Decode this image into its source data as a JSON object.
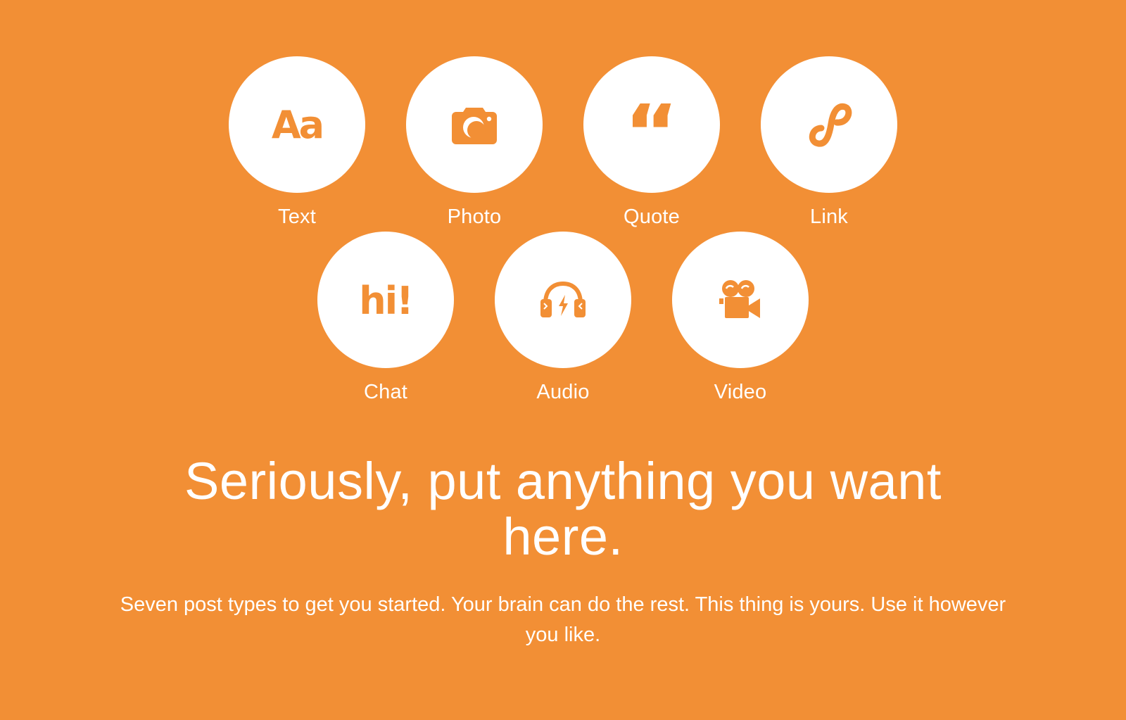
{
  "colors": {
    "background": "#f28f35",
    "circle": "#ffffff",
    "icon": "#f28f35",
    "text": "#ffffff"
  },
  "post_types": [
    {
      "label": "Text",
      "icon": "text-icon",
      "glyph": "Aa"
    },
    {
      "label": "Photo",
      "icon": "camera-icon"
    },
    {
      "label": "Quote",
      "icon": "quote-icon",
      "glyph": "“"
    },
    {
      "label": "Link",
      "icon": "link-icon"
    },
    {
      "label": "Chat",
      "icon": "chat-icon",
      "glyph": "hi!"
    },
    {
      "label": "Audio",
      "icon": "headphones-icon"
    },
    {
      "label": "Video",
      "icon": "video-camera-icon"
    }
  ],
  "headline": "Seriously, put anything you want here.",
  "subtext": "Seven post types to get you started. Your brain can do the rest. This thing is yours. Use it however you like."
}
